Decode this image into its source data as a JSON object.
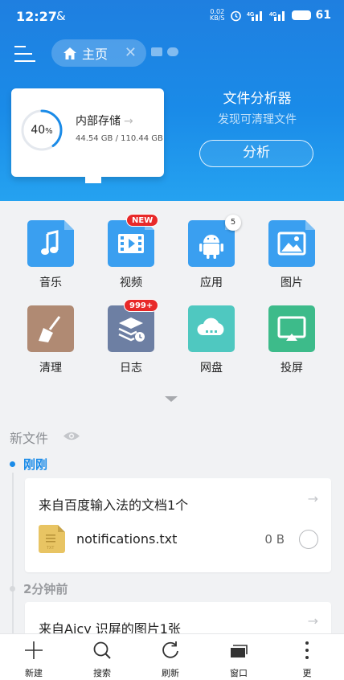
{
  "status_bar": {
    "time": "12:27",
    "link_glyph": "&",
    "net_speed_top": "0.02",
    "net_speed_bottom": "KB/S",
    "battery": "61"
  },
  "toolbar": {
    "home_tab_label": "主页",
    "close_glyph": "✕"
  },
  "storage": {
    "percent_value": "40",
    "percent_sign": "%",
    "percent_fraction": 0.4,
    "title": "内部存储",
    "arrow": "→",
    "size": "44.54 GB / 110.44 GB"
  },
  "analyzer": {
    "title": "文件分析器",
    "subtitle": "发现可清理文件",
    "button": "分析"
  },
  "apps": [
    {
      "label": "音乐",
      "icon": "music-icon",
      "color": "#3a9ff0"
    },
    {
      "label": "视频",
      "icon": "video-icon",
      "color": "#3a9ff0",
      "badge": "NEW"
    },
    {
      "label": "应用",
      "icon": "android-icon",
      "color": "#3a9ff0",
      "badge": "5"
    },
    {
      "label": "图片",
      "icon": "image-icon",
      "color": "#3a9ff0"
    },
    {
      "label": "清理",
      "icon": "broom-icon",
      "color": "#b08a73"
    },
    {
      "label": "日志",
      "icon": "log-icon",
      "color": "#6d7fa3",
      "badge": "999+"
    },
    {
      "label": "网盘",
      "icon": "cloud-icon",
      "color": "#4fc8c0"
    },
    {
      "label": "投屏",
      "icon": "cast-icon",
      "color": "#3dbb8a"
    }
  ],
  "new_files": {
    "title": "新文件",
    "groups": [
      {
        "time_label": "刚刚",
        "card_title": "来自百度输入法的文档1个",
        "arrow": "→",
        "file_name": "notifications.txt",
        "file_size": "0 B"
      },
      {
        "time_label": "2分钟前",
        "card_title": "来自Aicy 识屏的图片1张",
        "arrow": "→"
      }
    ]
  },
  "bottom_bar": [
    {
      "label": "新建",
      "icon": "plus-icon"
    },
    {
      "label": "搜索",
      "icon": "search-icon"
    },
    {
      "label": "刷新",
      "icon": "refresh-icon"
    },
    {
      "label": "窗口",
      "icon": "windows-icon"
    },
    {
      "label": "更",
      "icon": "more-icon"
    }
  ],
  "colors": {
    "accent": "#1a8be8",
    "badge_red": "#e82929"
  }
}
